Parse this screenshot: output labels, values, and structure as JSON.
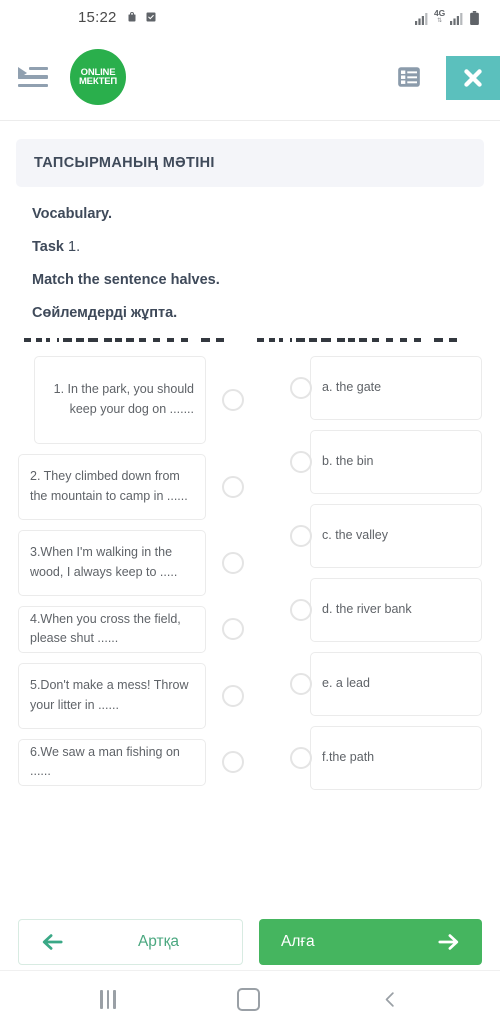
{
  "status_bar": {
    "time": "15:22",
    "left_icons": [
      "bag-icon",
      "checkbox-icon"
    ],
    "network_label": "4G",
    "right_icons": [
      "signal-icon",
      "network-4g-icon",
      "signal-icon",
      "battery-icon"
    ]
  },
  "header": {
    "menu_icon": "hamburger-menu-icon",
    "logo_line1": "ONLINE",
    "logo_line2": "МЕКТЕП",
    "list_icon": "list-view-icon",
    "globe_icon": "globe-language-icon",
    "close_icon": "close-x-icon"
  },
  "task": {
    "banner_title": "ТАПСЫРМАНЫҢ МӘТІНІ",
    "lines": [
      {
        "bold": "Vocabulary.",
        "normal": ""
      },
      {
        "bold": "Task ",
        "normal": "1."
      },
      {
        "bold": "Match the sentence halves.",
        "normal": ""
      },
      {
        "bold": "Сөйлемдерді жұпта.",
        "normal": ""
      }
    ]
  },
  "match": {
    "left_items": [
      {
        "id": "1",
        "text": "1. In the park, you should keep your dog on ......."
      },
      {
        "id": "2",
        "text": "2. They climbed down from the mountain to camp in ......"
      },
      {
        "id": "3",
        "text": "3.When I'm walking in the wood, I always keep to ....."
      },
      {
        "id": "4",
        "text": "4.When you cross the field, please shut ......"
      },
      {
        "id": "5",
        "text": "5.Don't make a mess! Throw your litter in ......"
      },
      {
        "id": "6",
        "text": "6.We saw a man fishing on ......"
      }
    ],
    "right_items": [
      {
        "id": "a",
        "text": "a. the gate"
      },
      {
        "id": "b",
        "text": "b. the bin"
      },
      {
        "id": "c",
        "text": "c. the valley"
      },
      {
        "id": "d",
        "text": "d. the river bank"
      },
      {
        "id": "e",
        "text": "e. a lead"
      },
      {
        "id": "f",
        "text": "f.the path"
      }
    ]
  },
  "footer": {
    "back_label": "Артқа",
    "back_icon": "arrow-left-icon",
    "next_label": "Алға",
    "next_icon": "arrow-right-icon"
  },
  "android_nav": {
    "recent_icon": "recent-apps-icon",
    "home_icon": "home-icon",
    "back_icon": "back-chevron-icon"
  },
  "colors": {
    "brand_green": "#2aaf4c",
    "button_green": "#45b55f",
    "teal": "#5bc0bd",
    "banner_bg": "#f4f5f9"
  }
}
